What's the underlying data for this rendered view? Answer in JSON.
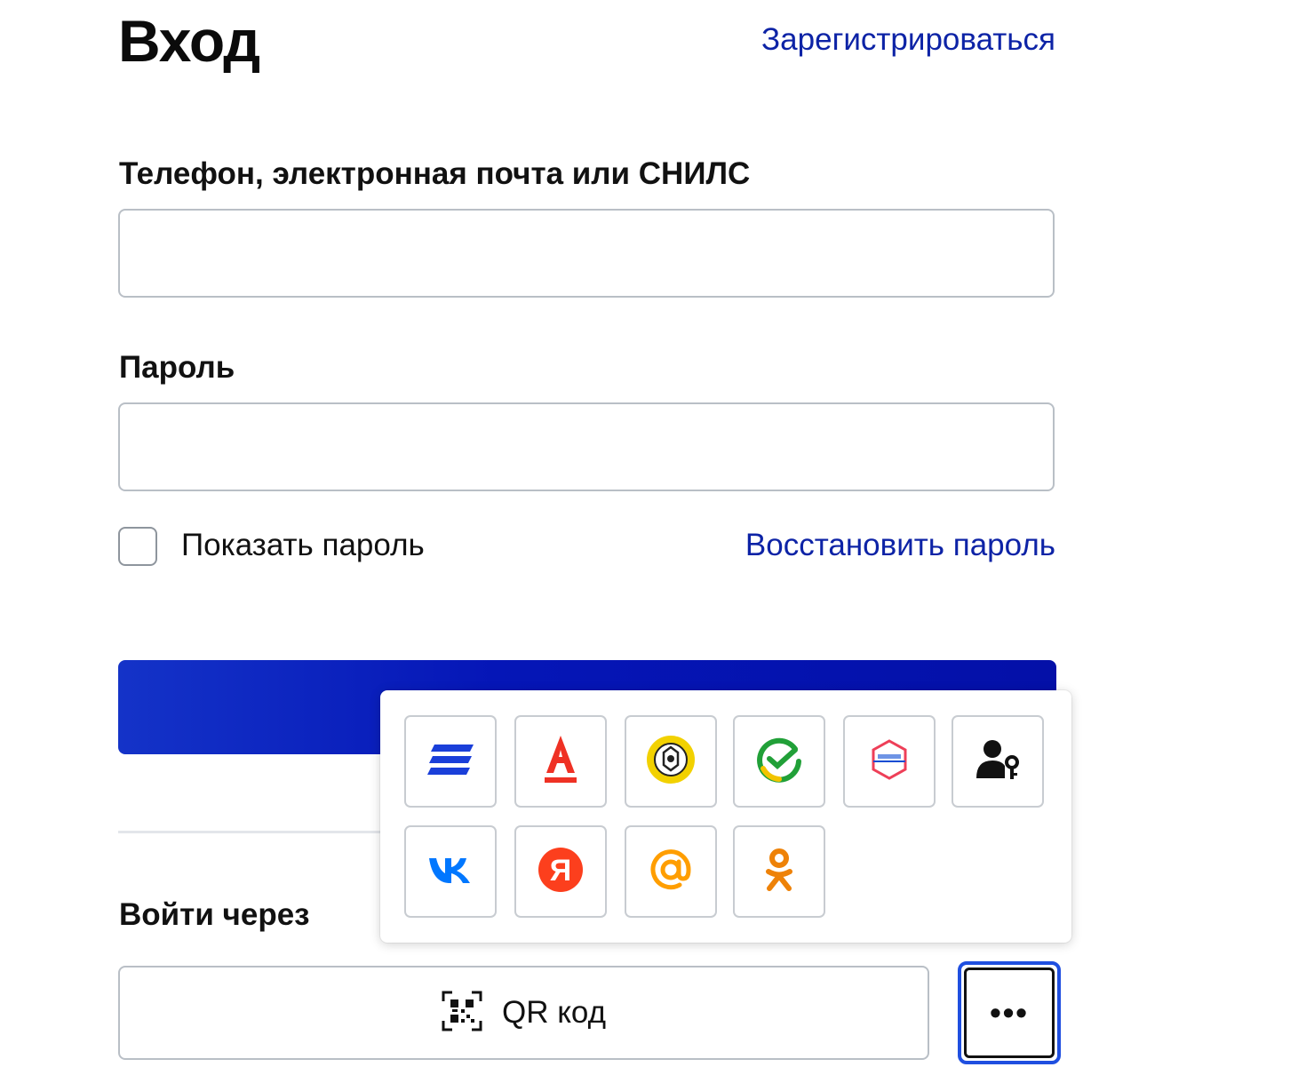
{
  "page": {
    "title": "Вход",
    "register_link": "Зарегистрироваться"
  },
  "form": {
    "login_label": "Телефон, электронная почта или СНИЛС",
    "login_value": "",
    "password_label": "Пароль",
    "password_value": "",
    "show_password_label": "Показать пароль",
    "show_password_checked": false,
    "restore_link": "Восстановить пароль",
    "submit_label": ""
  },
  "login_via": {
    "label": "Войти через",
    "qr_button": "QR код",
    "more_button": "•••"
  },
  "providers_popover": {
    "items": [
      {
        "icon": "tinkoff-stripes-icon",
        "color": "#1a3fd9"
      },
      {
        "icon": "alfa-bank-icon",
        "color": "#ef3124"
      },
      {
        "icon": "emblem-coin-icon",
        "color": "#f2d100"
      },
      {
        "icon": "sber-check-icon",
        "color": "#21a038"
      },
      {
        "icon": "gosuslugi-icon",
        "color": "#ee3f58"
      },
      {
        "icon": "user-key-icon",
        "color": "#111111"
      },
      {
        "icon": "vk-icon",
        "color": "#0077ff"
      },
      {
        "icon": "yandex-icon",
        "color": "#fc3f1d"
      },
      {
        "icon": "mail-at-icon",
        "color": "#ff9e00"
      },
      {
        "icon": "odnoklassniki-icon",
        "color": "#ee8208"
      }
    ]
  }
}
